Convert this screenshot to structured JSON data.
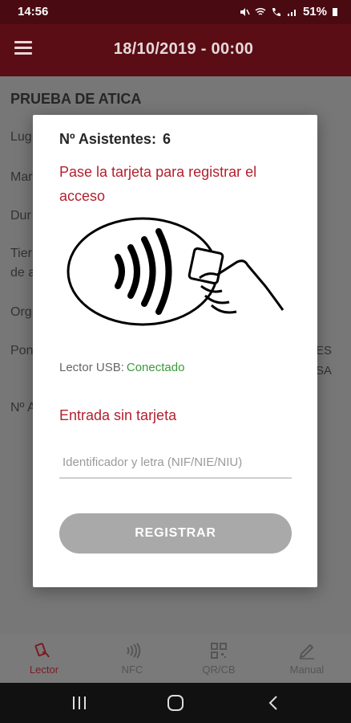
{
  "status_bar": {
    "time": "14:56",
    "battery": "51%"
  },
  "app_bar": {
    "title": "18/10/2019 - 00:00"
  },
  "background": {
    "title": "PRUEBA DE ATICA",
    "rows_left": [
      "Lug",
      "Mar",
      "Dur",
      "Tier",
      "de a",
      "Org",
      "Pon",
      "Nº A"
    ],
    "rows_right": [
      "ES",
      "SA"
    ]
  },
  "dialog": {
    "count_label": "Nº Asistentes:",
    "count_value": "6",
    "instruction": "Pase la tarjeta para registrar el acceso",
    "usb_label": "Lector USB:",
    "usb_status": "Conectado",
    "entry_label": "Entrada sin tarjeta",
    "input_placeholder": "Identificador y letra (NIF/NIE/NIU)",
    "input_value": "",
    "register_button": "REGISTRAR"
  },
  "bottom_nav": {
    "items": [
      {
        "label": "Lector",
        "icon": "card-reader-icon"
      },
      {
        "label": "NFC",
        "icon": "nfc-icon"
      },
      {
        "label": "QR/CB",
        "icon": "qr-code-icon"
      },
      {
        "label": "Manual",
        "icon": "pencil-icon"
      }
    ]
  },
  "colors": {
    "app_bar": "#5a0d15",
    "accent_red": "#b3212f",
    "status_ok": "#3a9a3a",
    "button_disabled": "#a9a9a9"
  }
}
